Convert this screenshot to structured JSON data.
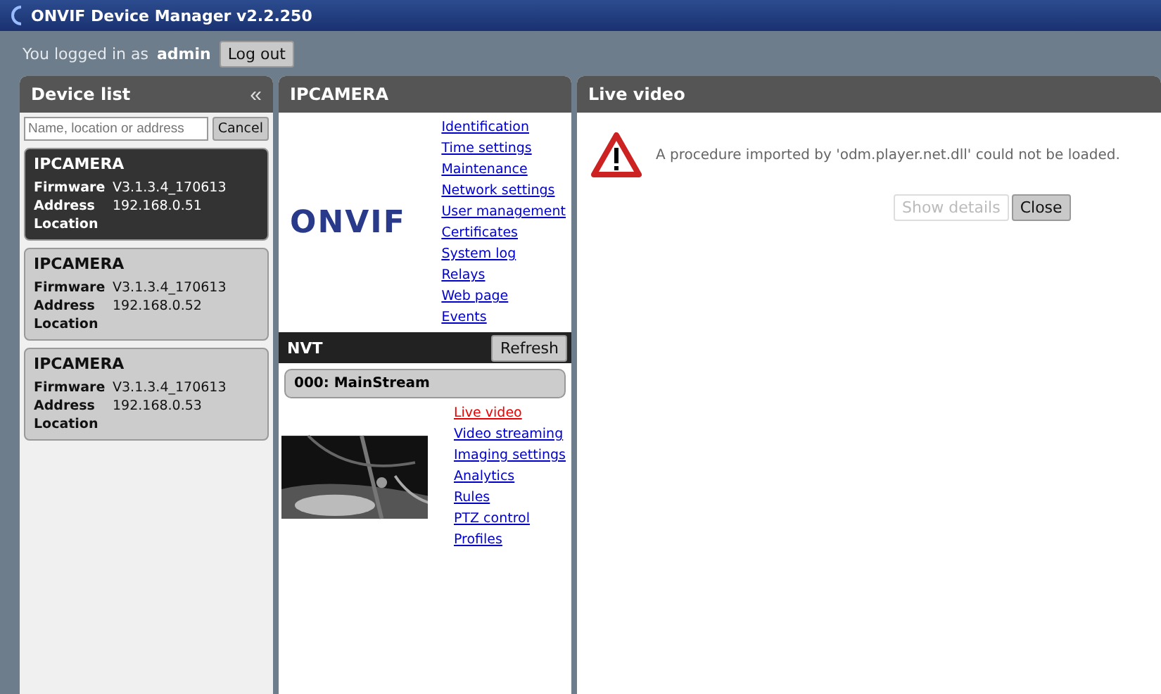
{
  "window": {
    "title": "ONVIF Device Manager v2.2.250"
  },
  "login": {
    "prefix": "You logged in as",
    "user": "admin",
    "button": "Log out"
  },
  "device_list": {
    "title": "Device list",
    "collapse": "«",
    "search": {
      "placeholder": "Name, location or address"
    },
    "cancel": "Cancel",
    "devices": [
      {
        "name": "IPCAMERA",
        "firmware_label": "Firmware",
        "firmware": "V3.1.3.4_170613",
        "address_label": "Address",
        "address": "192.168.0.51",
        "location_label": "Location",
        "selected": true
      },
      {
        "name": "IPCAMERA",
        "firmware_label": "Firmware",
        "firmware": "V3.1.3.4_170613",
        "address_label": "Address",
        "address": "192.168.0.52",
        "location_label": "Location",
        "selected": false
      },
      {
        "name": "IPCAMERA",
        "firmware_label": "Firmware",
        "firmware": "V3.1.3.4_170613",
        "address_label": "Address",
        "address": "192.168.0.53",
        "location_label": "Location",
        "selected": false
      }
    ]
  },
  "device": {
    "title": "IPCAMERA",
    "logo": "ONVIF",
    "links": [
      {
        "label": "Identification",
        "selected": false
      },
      {
        "label": "Time settings",
        "selected": false
      },
      {
        "label": "Maintenance",
        "selected": false
      },
      {
        "label": "Network settings",
        "selected": false
      },
      {
        "label": "User management",
        "selected": false
      },
      {
        "label": "Certificates",
        "selected": false
      },
      {
        "label": "System log",
        "selected": false
      },
      {
        "label": "Relays",
        "selected": false
      },
      {
        "label": "Web page",
        "selected": false
      },
      {
        "label": "Events",
        "selected": false
      }
    ]
  },
  "nvt": {
    "title": "NVT",
    "refresh": "Refresh",
    "stream": "000: MainStream",
    "links": [
      {
        "label": "Live video",
        "selected": true
      },
      {
        "label": "Video streaming",
        "selected": false
      },
      {
        "label": "Imaging settings",
        "selected": false
      },
      {
        "label": "Analytics",
        "selected": false
      },
      {
        "label": "Rules",
        "selected": false
      },
      {
        "label": "PTZ control",
        "selected": false
      },
      {
        "label": "Profiles",
        "selected": false
      }
    ]
  },
  "live_video": {
    "title": "Live video",
    "message": "A procedure imported by 'odm.player.net.dll' could not be loaded.",
    "buttons": [
      {
        "label": "Show details",
        "disabled": true
      },
      {
        "label": "Close",
        "disabled": false
      }
    ]
  }
}
